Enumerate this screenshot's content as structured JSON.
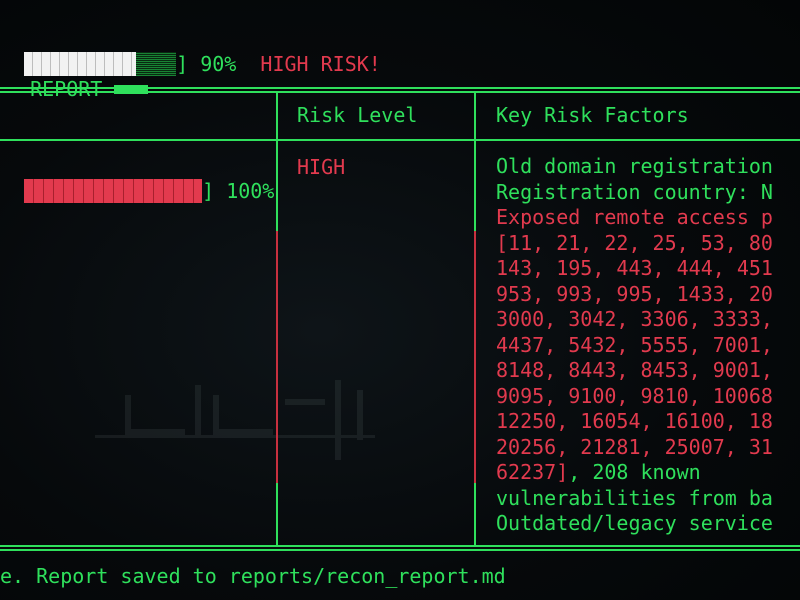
{
  "top_progress": {
    "percent_label": "90%",
    "fraction": 0.9,
    "status": "HIGH RISK!"
  },
  "report_heading": {
    "text": "REPORT"
  },
  "table": {
    "headers": [
      "Risk Level",
      "Key Risk Factors"
    ],
    "row": {
      "percent_label": "100%",
      "fraction": 1.0,
      "risk_level": "HIGH",
      "factor_lines": [
        {
          "text": "Old domain registration",
          "color": "green"
        },
        {
          "text": "Registration country: N",
          "color": "green"
        },
        {
          "text": "Exposed remote access p",
          "color": "red"
        },
        {
          "text": "[11, 21, 22, 25, 53, 80",
          "color": "red"
        },
        {
          "text": "143, 195, 443, 444, 451",
          "color": "red"
        },
        {
          "text": "953, 993, 995, 1433, 20",
          "color": "red"
        },
        {
          "text": "3000, 3042, 3306, 3333,",
          "color": "red"
        },
        {
          "text": "4437, 5432, 5555, 7001,",
          "color": "red"
        },
        {
          "text": "8148, 8443, 8453, 9001,",
          "color": "red"
        },
        {
          "text": "9095, 9100, 9810, 10068",
          "color": "red"
        },
        {
          "text": "12250, 16054, 16100, 18",
          "color": "red"
        },
        {
          "text": "20256, 21281, 25007, 31",
          "color": "red"
        },
        {
          "text": "62237], 208 known",
          "color": "mixed"
        },
        {
          "text": "vulnerabilities from ba",
          "color": "green"
        },
        {
          "text": "Outdated/legacy service",
          "color": "green"
        }
      ]
    }
  },
  "footer": {
    "text": "e. Report saved to reports/recon_report.md"
  },
  "colors": {
    "green": "#2fe05c",
    "red": "#e23a4e",
    "background": "#05080a"
  }
}
